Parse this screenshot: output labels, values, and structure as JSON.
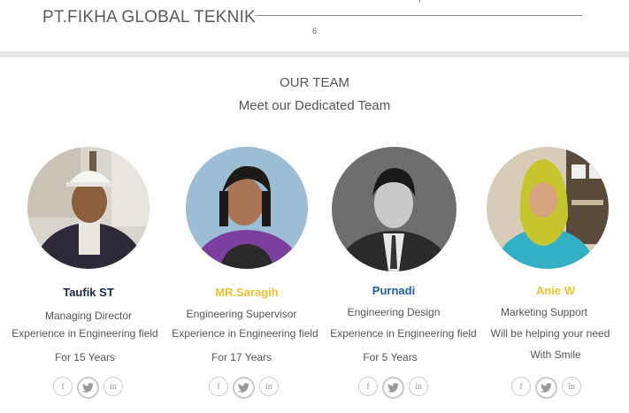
{
  "header": {
    "brand": "PT.FIKHA GLOBAL TEKNIK",
    "page_number": "6"
  },
  "section": {
    "title": "OUR TEAM",
    "subtitle": "Meet our Dedicated Team"
  },
  "colors": {
    "navy": "#17274f",
    "gold": "#f2c12e",
    "blue": "#1f5fa6",
    "divider": "#e6e6e6"
  },
  "team": [
    {
      "name": "Taufik ST",
      "role": "Managing  Director",
      "line2": "Experience in Engineering field",
      "line3": "For 15 Years",
      "name_color": "#17274f"
    },
    {
      "name": "MR.Saragih",
      "role": "Engineering  Supervisor",
      "line2": "Experience in Engineering field",
      "line3": "For 17 Years",
      "name_color": "#f2c12e"
    },
    {
      "name": "Purnadi",
      "role": "Engineering  Design",
      "line2": "Experience in Engineering field",
      "line3": "For 5 Years",
      "name_color": "#1f5fa6"
    },
    {
      "name": "Anie W",
      "role": "Marketing Support",
      "line2": "Will be helping your need",
      "line3": "With Smile",
      "name_color": "#f2c12e"
    }
  ],
  "social_icons": {
    "facebook": "f",
    "twitter": "t",
    "linkedin": "in"
  }
}
